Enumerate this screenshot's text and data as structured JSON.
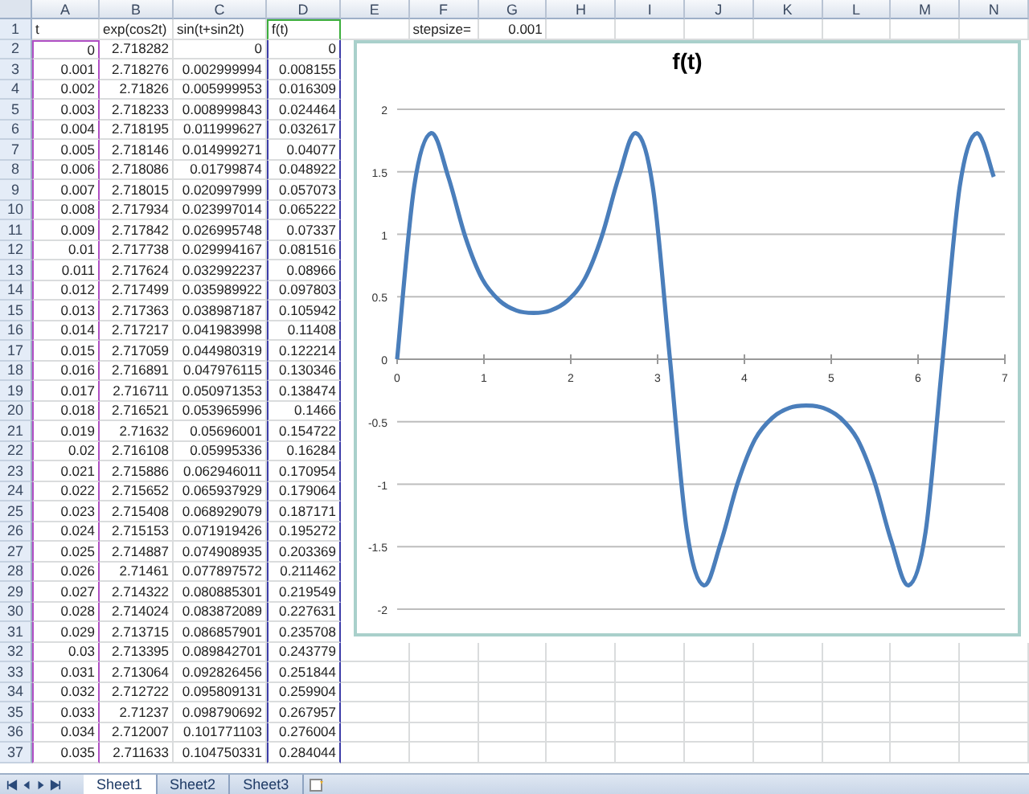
{
  "columns": [
    "A",
    "B",
    "C",
    "D",
    "E",
    "F",
    "G",
    "H",
    "I",
    "J",
    "K",
    "L",
    "M",
    "N"
  ],
  "rows": [
    {
      "number": "1",
      "kind": "text",
      "cells": [
        "t",
        "exp(cos2t)",
        "sin(t+sin2t)",
        "f(t)"
      ]
    },
    {
      "number": "2",
      "kind": "number",
      "cells": [
        "0",
        "2.718282",
        "0",
        "0"
      ]
    },
    {
      "number": "3",
      "kind": "number",
      "cells": [
        "0.001",
        "2.718276",
        "0.002999994",
        "0.008155"
      ]
    },
    {
      "number": "4",
      "kind": "number",
      "cells": [
        "0.002",
        "2.71826",
        "0.005999953",
        "0.016309"
      ]
    },
    {
      "number": "5",
      "kind": "number",
      "cells": [
        "0.003",
        "2.718233",
        "0.008999843",
        "0.024464"
      ]
    },
    {
      "number": "6",
      "kind": "number",
      "cells": [
        "0.004",
        "2.718195",
        "0.011999627",
        "0.032617"
      ]
    },
    {
      "number": "7",
      "kind": "number",
      "cells": [
        "0.005",
        "2.718146",
        "0.014999271",
        "0.04077"
      ]
    },
    {
      "number": "8",
      "kind": "number",
      "cells": [
        "0.006",
        "2.718086",
        "0.01799874",
        "0.048922"
      ]
    },
    {
      "number": "9",
      "kind": "number",
      "cells": [
        "0.007",
        "2.718015",
        "0.020997999",
        "0.057073"
      ]
    },
    {
      "number": "10",
      "kind": "number",
      "cells": [
        "0.008",
        "2.717934",
        "0.023997014",
        "0.065222"
      ]
    },
    {
      "number": "11",
      "kind": "number",
      "cells": [
        "0.009",
        "2.717842",
        "0.026995748",
        "0.07337"
      ]
    },
    {
      "number": "12",
      "kind": "number",
      "cells": [
        "0.01",
        "2.717738",
        "0.029994167",
        "0.081516"
      ]
    },
    {
      "number": "13",
      "kind": "number",
      "cells": [
        "0.011",
        "2.717624",
        "0.032992237",
        "0.08966"
      ]
    },
    {
      "number": "14",
      "kind": "number",
      "cells": [
        "0.012",
        "2.717499",
        "0.035989922",
        "0.097803"
      ]
    },
    {
      "number": "15",
      "kind": "number",
      "cells": [
        "0.013",
        "2.717363",
        "0.038987187",
        "0.105942"
      ]
    },
    {
      "number": "16",
      "kind": "number",
      "cells": [
        "0.014",
        "2.717217",
        "0.041983998",
        "0.11408"
      ]
    },
    {
      "number": "17",
      "kind": "number",
      "cells": [
        "0.015",
        "2.717059",
        "0.044980319",
        "0.122214"
      ]
    },
    {
      "number": "18",
      "kind": "number",
      "cells": [
        "0.016",
        "2.716891",
        "0.047976115",
        "0.130346"
      ]
    },
    {
      "number": "19",
      "kind": "number",
      "cells": [
        "0.017",
        "2.716711",
        "0.050971353",
        "0.138474"
      ]
    },
    {
      "number": "20",
      "kind": "number",
      "cells": [
        "0.018",
        "2.716521",
        "0.053965996",
        "0.1466"
      ]
    },
    {
      "number": "21",
      "kind": "number",
      "cells": [
        "0.019",
        "2.71632",
        "0.05696001",
        "0.154722"
      ]
    },
    {
      "number": "22",
      "kind": "number",
      "cells": [
        "0.02",
        "2.716108",
        "0.05995336",
        "0.16284"
      ]
    },
    {
      "number": "23",
      "kind": "number",
      "cells": [
        "0.021",
        "2.715886",
        "0.062946011",
        "0.170954"
      ]
    },
    {
      "number": "24",
      "kind": "number",
      "cells": [
        "0.022",
        "2.715652",
        "0.065937929",
        "0.179064"
      ]
    },
    {
      "number": "25",
      "kind": "number",
      "cells": [
        "0.023",
        "2.715408",
        "0.068929079",
        "0.187171"
      ]
    },
    {
      "number": "26",
      "kind": "number",
      "cells": [
        "0.024",
        "2.715153",
        "0.071919426",
        "0.195272"
      ]
    },
    {
      "number": "27",
      "kind": "number",
      "cells": [
        "0.025",
        "2.714887",
        "0.074908935",
        "0.203369"
      ]
    },
    {
      "number": "28",
      "kind": "number",
      "cells": [
        "0.026",
        "2.71461",
        "0.077897572",
        "0.211462"
      ]
    },
    {
      "number": "29",
      "kind": "number",
      "cells": [
        "0.027",
        "2.714322",
        "0.080885301",
        "0.219549"
      ]
    },
    {
      "number": "30",
      "kind": "number",
      "cells": [
        "0.028",
        "2.714024",
        "0.083872089",
        "0.227631"
      ]
    },
    {
      "number": "31",
      "kind": "number",
      "cells": [
        "0.029",
        "2.713715",
        "0.086857901",
        "0.235708"
      ]
    },
    {
      "number": "32",
      "kind": "number",
      "cells": [
        "0.03",
        "2.713395",
        "0.089842701",
        "0.243779"
      ]
    },
    {
      "number": "33",
      "kind": "number",
      "cells": [
        "0.031",
        "2.713064",
        "0.092826456",
        "0.251844"
      ]
    },
    {
      "number": "34",
      "kind": "number",
      "cells": [
        "0.032",
        "2.712722",
        "0.095809131",
        "0.259904"
      ]
    },
    {
      "number": "35",
      "kind": "number",
      "cells": [
        "0.033",
        "2.71237",
        "0.098790692",
        "0.267957"
      ]
    },
    {
      "number": "36",
      "kind": "number",
      "cells": [
        "0.034",
        "2.712007",
        "0.101771103",
        "0.276004"
      ]
    },
    {
      "number": "37",
      "kind": "number",
      "cells": [
        "0.035",
        "2.711633",
        "0.104750331",
        "0.284044"
      ]
    }
  ],
  "stepsize": {
    "label": "stepsize=",
    "value": "0.001"
  },
  "chart": {
    "selected": true,
    "chart_data": {
      "type": "line",
      "title": "f(t)",
      "grid": true,
      "x": [
        0,
        0.196,
        0.393,
        0.589,
        0.785,
        0.982,
        1.178,
        1.374,
        1.571,
        1.767,
        1.963,
        2.16,
        2.356,
        2.553,
        2.749,
        2.945,
        3.142,
        3.338,
        3.534,
        3.731,
        3.927,
        4.123,
        4.32,
        4.516,
        4.712,
        4.909,
        5.105,
        5.301,
        5.498,
        5.694,
        5.89,
        6.087,
        6.283,
        6.48,
        6.676,
        6.872
      ],
      "series": [
        {
          "color": "#4a7ebb",
          "values": [
            0,
            1.38,
            1.81,
            1.46,
            0.98,
            0.64,
            0.47,
            0.39,
            0.37,
            0.39,
            0.47,
            0.64,
            0.98,
            1.46,
            1.81,
            1.38,
            0,
            -1.38,
            -1.81,
            -1.46,
            -0.98,
            -0.64,
            -0.47,
            -0.39,
            -0.37,
            -0.39,
            -0.47,
            -0.64,
            -0.98,
            -1.46,
            -1.81,
            -1.38,
            0,
            1.38,
            1.81,
            1.46
          ]
        }
      ],
      "xlim": [
        0,
        7
      ],
      "ylim": [
        -2,
        2
      ],
      "xticks": [
        0,
        1,
        2,
        3,
        4,
        5,
        6,
        7
      ],
      "yticks": [
        2,
        1.5,
        1,
        0.5,
        0,
        -0.5,
        -1,
        -1.5,
        -2
      ]
    }
  },
  "sheet_tabs": [
    {
      "label": "Sheet1",
      "selected": true
    },
    {
      "label": "Sheet2",
      "selected": false
    },
    {
      "label": "Sheet3",
      "selected": false
    }
  ]
}
